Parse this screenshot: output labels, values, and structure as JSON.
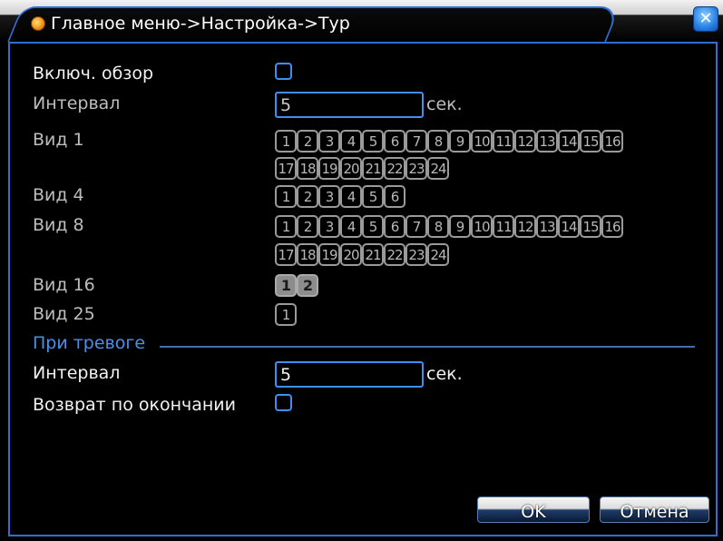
{
  "title": "Главное меню->Настройка->Тур",
  "close_icon": "close-icon",
  "rows": {
    "enable_tour": {
      "label": "Включ. обзор",
      "checked": false
    },
    "interval": {
      "label": "Интервал",
      "value": "5",
      "unit": "сек."
    },
    "view1": {
      "label": "Вид 1",
      "cells_line1": [
        "1",
        "2",
        "3",
        "4",
        "5",
        "6",
        "7",
        "8",
        "9",
        "10",
        "11",
        "12",
        "13",
        "14",
        "15",
        "16"
      ],
      "cells_line2": [
        "17",
        "18",
        "19",
        "20",
        "21",
        "22",
        "23",
        "24"
      ]
    },
    "view4": {
      "label": "Вид 4",
      "cells": [
        "1",
        "2",
        "3",
        "4",
        "5",
        "6"
      ]
    },
    "view8": {
      "label": "Вид 8",
      "cells_line1": [
        "1",
        "2",
        "3",
        "4",
        "5",
        "6",
        "7",
        "8",
        "9",
        "10",
        "11",
        "12",
        "13",
        "14",
        "15",
        "16"
      ],
      "cells_line2": [
        "17",
        "18",
        "19",
        "20",
        "21",
        "22",
        "23",
        "24"
      ]
    },
    "view16": {
      "label": "Вид 16",
      "cells": [
        "1",
        "2"
      ],
      "selected": [
        "1",
        "2"
      ]
    },
    "view25": {
      "label": "Вид 25",
      "cells": [
        "1"
      ]
    }
  },
  "alarm_section": {
    "header": "При тревоге",
    "interval": {
      "label": "Интервал",
      "value": "5",
      "unit": "сек."
    },
    "return_on_end": {
      "label": "Возврат по окончании",
      "checked": false
    }
  },
  "buttons": {
    "ok": "OK",
    "cancel": "Отмена"
  },
  "colors": {
    "accent": "#2f6fd0",
    "section_label": "#4c8fe8"
  }
}
